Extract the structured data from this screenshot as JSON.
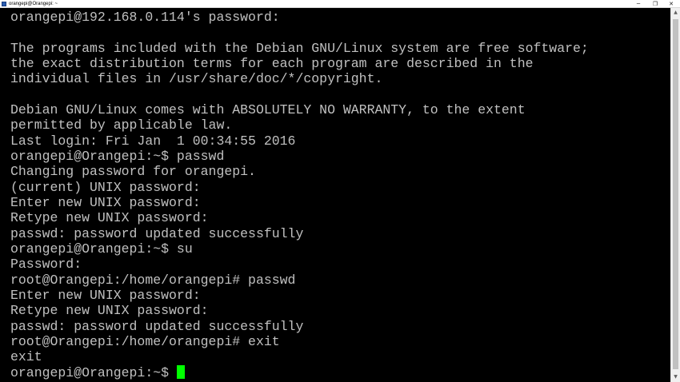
{
  "window": {
    "title": "orangepi@Orangepi: ~",
    "minimize_glyph": "─",
    "maximize_glyph": "❐",
    "close_glyph": "✕"
  },
  "terminal": {
    "lines": [
      "orangepi@192.168.0.114's password:",
      "",
      "The programs included with the Debian GNU/Linux system are free software;",
      "the exact distribution terms for each program are described in the",
      "individual files in /usr/share/doc/*/copyright.",
      "",
      "Debian GNU/Linux comes with ABSOLUTELY NO WARRANTY, to the extent",
      "permitted by applicable law.",
      "Last login: Fri Jan  1 00:34:55 2016",
      "orangepi@Orangepi:~$ passwd",
      "Changing password for orangepi.",
      "(current) UNIX password:",
      "Enter new UNIX password:",
      "Retype new UNIX password:",
      "passwd: password updated successfully",
      "orangepi@Orangepi:~$ su",
      "Password:",
      "root@Orangepi:/home/orangepi# passwd",
      "Enter new UNIX password:",
      "Retype new UNIX password:",
      "passwd: password updated successfully",
      "root@Orangepi:/home/orangepi# exit",
      "exit"
    ],
    "prompt": "orangepi@Orangepi:~$ ",
    "cursor_color": "#00ff00",
    "text_color": "#c0c0c0",
    "background_color": "#000000"
  },
  "scrollbar": {
    "up_glyph": "▲",
    "down_glyph": "▼"
  }
}
